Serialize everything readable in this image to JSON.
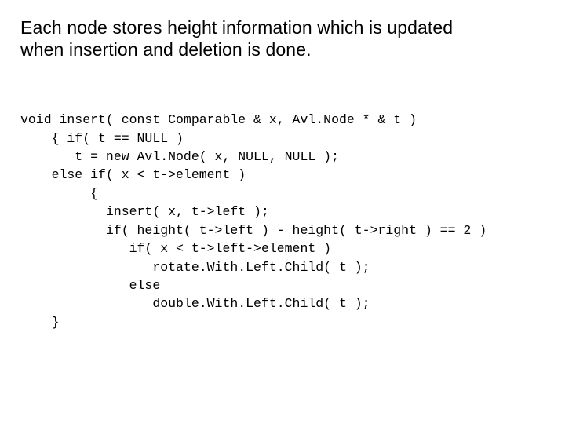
{
  "heading": {
    "line1": "Each node stores height information which is updated",
    "line2": "when insertion and deletion is done."
  },
  "code": {
    "l01": "void insert( const Comparable & x, Avl.Node * & t )",
    "l02": "    { if( t == NULL )",
    "l03": "       t = new Avl.Node( x, NULL, NULL );",
    "l04": "    else if( x < t->element )",
    "l05": "         {",
    "l06": "           insert( x, t->left );",
    "l07": "           if( height( t->left ) - height( t->right ) == 2 )",
    "l08": "              if( x < t->left->element )",
    "l09": "                 rotate.With.Left.Child( t );",
    "l10": "              else",
    "l11": "                 double.With.Left.Child( t );",
    "l12": "    }"
  }
}
